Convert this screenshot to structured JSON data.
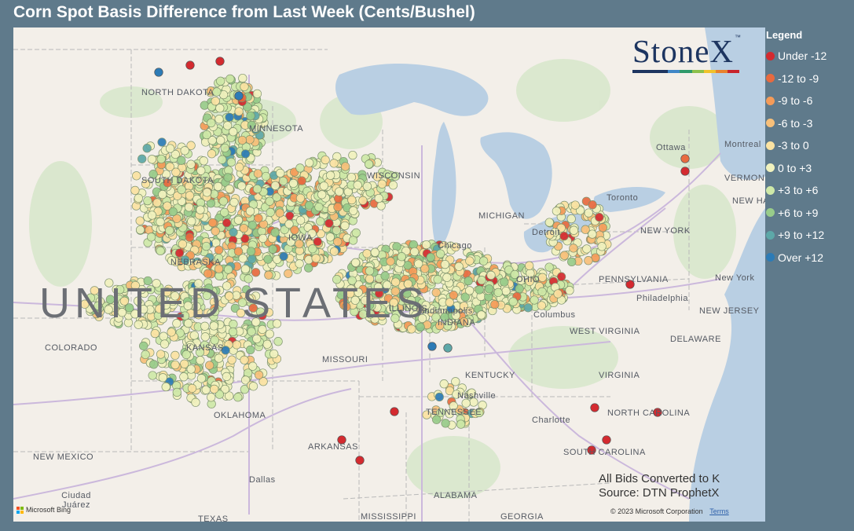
{
  "title": "Corn Spot Basis Difference from Last Week (Cents/Bushel)",
  "legend": {
    "title": "Legend",
    "items": [
      {
        "label": "Under -12",
        "color": "#d42a2f"
      },
      {
        "label": "-12 to -9",
        "color": "#e86a3f"
      },
      {
        "label": "-9 to -6",
        "color": "#f59b58"
      },
      {
        "label": "-6 to -3",
        "color": "#f8c07a"
      },
      {
        "label": "-3 to 0",
        "color": "#fbe3a2"
      },
      {
        "label": "0 to +3",
        "color": "#f1f2be"
      },
      {
        "label": "+3 to +6",
        "color": "#cfe9a8"
      },
      {
        "label": "+6 to +9",
        "color": "#98cc8a"
      },
      {
        "label": "+9 to +12",
        "color": "#5da8a8"
      },
      {
        "label": "Over +12",
        "color": "#2c7bb6"
      }
    ]
  },
  "logo": {
    "text": "StoneX",
    "trademark": "™"
  },
  "notes": {
    "line1": "All Bids Converted to K",
    "line2": "Source: DTN ProphetX"
  },
  "attribution": {
    "bing": "Microsoft Bing",
    "copyright": "© 2023 Microsoft Corporation",
    "terms": "Terms"
  },
  "map_labels": {
    "country": "UNITED STATES",
    "states": [
      "NORTH DAKOTA",
      "SOUTH DAKOTA",
      "MINNESOTA",
      "WISCONSIN",
      "MICHIGAN",
      "NEBRASKA",
      "IOWA",
      "ILLINOIS",
      "INDIANA",
      "OHIO",
      "COLORADO",
      "KANSAS",
      "MISSOURI",
      "KENTUCKY",
      "WEST VIRGINIA",
      "VIRGINIA",
      "PENNSYLVANIA",
      "NEW YORK",
      "VERMONT",
      "NEW HAMPSHIRE",
      "NEW JERSEY",
      "DELAWARE",
      "TENNESSEE",
      "NORTH CAROLINA",
      "SOUTH CAROLINA",
      "OKLAHOMA",
      "ARKANSAS",
      "MISSISSIPPI",
      "ALABAMA",
      "GEORGIA",
      "NEW MEXICO",
      "TEXAS"
    ],
    "cities": [
      "Chicago",
      "Columbus",
      "Indianapolis",
      "Nashville",
      "Charlotte",
      "Philadelphia",
      "New York",
      "Montreal",
      "Ottawa",
      "Toronto",
      "Detroit",
      "Dallas",
      "Ciudad Juárez"
    ]
  },
  "map_colors": {
    "land": "#f3efe9",
    "water": "#b9cfe3",
    "roads": "#c8b6da"
  }
}
